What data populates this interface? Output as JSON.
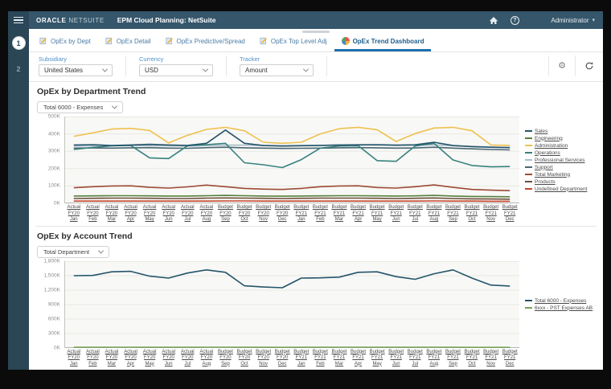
{
  "header": {
    "brand_primary": "ORACLE",
    "brand_secondary": "NETSUITE",
    "app_title": "EPM Cloud Planning: NetSuite",
    "user_menu": "Administrator"
  },
  "icons": {
    "gear": "⚙",
    "caret_down": "▾"
  },
  "sidebar": {
    "pages": [
      "1",
      "2"
    ],
    "active_page": "1"
  },
  "tabs": [
    {
      "label": "OpEx by Dept",
      "active": false
    },
    {
      "label": "OpEx Detail",
      "active": false
    },
    {
      "label": "OpEx Predictive/Spread",
      "active": false
    },
    {
      "label": "OpEx Top Level Adj",
      "active": false
    },
    {
      "label": "OpEx Trend Dashboard",
      "active": true
    }
  ],
  "filters": [
    {
      "label": "Subsidiary",
      "value": "United States"
    },
    {
      "label": "Currency",
      "value": "USD"
    },
    {
      "label": "Tracker",
      "value": "Amount"
    }
  ],
  "chart_data": [
    {
      "type": "line",
      "title": "OpEx by Department Trend",
      "selector": "Total 6000 - Expenses",
      "ylim": [
        0,
        500
      ],
      "yticks": [
        "500K",
        "400K",
        "300K",
        "200K",
        "100K",
        "0K"
      ],
      "grid": true,
      "legend_position": "right",
      "categories": [
        [
          "Actual",
          "FY20",
          "Jan"
        ],
        [
          "Actual",
          "FY20",
          "Feb"
        ],
        [
          "Actual",
          "FY20",
          "Mar"
        ],
        [
          "Actual",
          "FY20",
          "Apr"
        ],
        [
          "Actual",
          "FY20",
          "May"
        ],
        [
          "Actual",
          "FY20",
          "Jun"
        ],
        [
          "Actual",
          "FY20",
          "Jul"
        ],
        [
          "Actual",
          "FY20",
          "Aug"
        ],
        [
          "Budget",
          "FY20",
          "Sep"
        ],
        [
          "Budget",
          "FY20",
          "Oct"
        ],
        [
          "Budget",
          "FY20",
          "Nov"
        ],
        [
          "Budget",
          "FY20",
          "Dec"
        ],
        [
          "Budget",
          "FY21",
          "Jan"
        ],
        [
          "Budget",
          "FY21",
          "Feb"
        ],
        [
          "Budget",
          "FY21",
          "Mar"
        ],
        [
          "Budget",
          "FY21",
          "Apr"
        ],
        [
          "Budget",
          "FY21",
          "May"
        ],
        [
          "Budget",
          "FY21",
          "Jun"
        ],
        [
          "Budget",
          "FY21",
          "Jul"
        ],
        [
          "Budget",
          "FY21",
          "Aug"
        ],
        [
          "Budget",
          "FY21",
          "Sep"
        ],
        [
          "Budget",
          "FY21",
          "Oct"
        ],
        [
          "Budget",
          "FY21",
          "Nov"
        ],
        [
          "Budget",
          "FY21",
          "Dec"
        ]
      ],
      "series": [
        {
          "name": "Sales",
          "color": "#24546b",
          "z": 8,
          "values": [
            336,
            338,
            333,
            336,
            340,
            336,
            334,
            346,
            422,
            346,
            333,
            330,
            332,
            334,
            336,
            337,
            338,
            335,
            337,
            352,
            333,
            327,
            323,
            321
          ]
        },
        {
          "name": "Engineering",
          "color": "#55803e",
          "z": 4,
          "values": [
            42,
            43,
            44,
            44,
            43,
            42,
            42,
            44,
            46,
            44,
            42,
            41,
            42,
            43,
            44,
            44,
            43,
            42,
            43,
            46,
            42,
            40,
            39,
            38
          ]
        },
        {
          "name": "Administration",
          "color": "#efc14f",
          "z": 9,
          "values": [
            386,
            406,
            428,
            432,
            420,
            348,
            392,
            426,
            438,
            418,
            352,
            346,
            352,
            400,
            430,
            438,
            424,
            356,
            402,
            434,
            438,
            418,
            336,
            334
          ]
        },
        {
          "name": "Operations",
          "color": "#37817f",
          "z": 7,
          "values": [
            310,
            322,
            331,
            334,
            262,
            258,
            332,
            338,
            346,
            234,
            222,
            206,
            252,
            318,
            330,
            332,
            246,
            242,
            330,
            346,
            250,
            218,
            210,
            212
          ]
        },
        {
          "name": "Professional Services",
          "color": "#a9bdc8",
          "z": 5,
          "values": [
            330,
            331,
            332,
            333,
            332,
            331,
            330,
            333,
            335,
            335,
            333,
            332,
            333,
            334,
            336,
            336,
            335,
            334,
            335,
            337,
            332,
            328,
            324,
            322
          ]
        },
        {
          "name": "Support",
          "color": "#4a6673",
          "z": 6,
          "values": [
            318,
            319,
            318,
            320,
            321,
            318,
            317,
            321,
            323,
            320,
            318,
            316,
            317,
            318,
            320,
            321,
            320,
            318,
            319,
            323,
            318,
            314,
            310,
            308
          ]
        },
        {
          "name": "Total Marketing",
          "color": "#9d4a35",
          "z": 3,
          "values": [
            90,
            96,
            100,
            101,
            92,
            88,
            95,
            105,
            96,
            86,
            82,
            80,
            86,
            96,
            100,
            101,
            91,
            88,
            96,
            106,
            92,
            80,
            76,
            73
          ]
        },
        {
          "name": "Products",
          "color": "#6e4f3c",
          "z": 2,
          "values": [
            28,
            29,
            30,
            30,
            29,
            28,
            28,
            30,
            31,
            30,
            29,
            28,
            29,
            30,
            30,
            30,
            29,
            28,
            29,
            31,
            28,
            26,
            25,
            24
          ]
        },
        {
          "name": "Undefined Department",
          "color": "#c8452c",
          "z": 1,
          "values": [
            13,
            13,
            13,
            13,
            13,
            13,
            13,
            13,
            14,
            14,
            13,
            13,
            13,
            13,
            13,
            13,
            13,
            13,
            13,
            14,
            13,
            13,
            12,
            12
          ]
        }
      ]
    },
    {
      "type": "line",
      "title": "OpEx by Account Trend",
      "selector": "Total Department",
      "ylim": [
        0,
        1800
      ],
      "yticks": [
        "1,800K",
        "1,500K",
        "1,200K",
        "900K",
        "600K",
        "300K",
        "0K"
      ],
      "grid": true,
      "legend_position": "right",
      "categories": [
        [
          "Actual",
          "FY20",
          "Jan"
        ],
        [
          "Actual",
          "FY20",
          "Feb"
        ],
        [
          "Actual",
          "FY20",
          "Mar"
        ],
        [
          "Actual",
          "FY20",
          "Apr"
        ],
        [
          "Actual",
          "FY20",
          "May"
        ],
        [
          "Actual",
          "FY20",
          "Jun"
        ],
        [
          "Actual",
          "FY20",
          "Jul"
        ],
        [
          "Actual",
          "FY20",
          "Aug"
        ],
        [
          "Budget",
          "FY20",
          "Sep"
        ],
        [
          "Budget",
          "FY20",
          "Oct"
        ],
        [
          "Budget",
          "FY20",
          "Nov"
        ],
        [
          "Budget",
          "FY20",
          "Dec"
        ],
        [
          "Budget",
          "FY21",
          "Jan"
        ],
        [
          "Budget",
          "FY21",
          "Feb"
        ],
        [
          "Budget",
          "FY21",
          "Mar"
        ],
        [
          "Budget",
          "FY21",
          "Apr"
        ],
        [
          "Budget",
          "FY21",
          "May"
        ],
        [
          "Budget",
          "FY21",
          "Jun"
        ],
        [
          "Budget",
          "FY21",
          "Jul"
        ],
        [
          "Budget",
          "FY21",
          "Aug"
        ],
        [
          "Budget",
          "FY21",
          "Sep"
        ],
        [
          "Budget",
          "FY21",
          "Oct"
        ],
        [
          "Budget",
          "FY21",
          "Nov"
        ],
        [
          "Budget",
          "FY21",
          "Dec"
        ]
      ],
      "series": [
        {
          "name": "Total 6000 - Expenses",
          "color": "#24546b",
          "z": 2,
          "values": [
            1500,
            1505,
            1580,
            1590,
            1490,
            1450,
            1555,
            1620,
            1570,
            1290,
            1265,
            1250,
            1450,
            1455,
            1470,
            1570,
            1580,
            1480,
            1425,
            1540,
            1620,
            1450,
            1305,
            1285
          ]
        },
        {
          "name": "6xxx - PST Expenses AB",
          "color": "#76a15a",
          "z": 1,
          "values": [
            15,
            15,
            16,
            16,
            15,
            15,
            15,
            16,
            16,
            15,
            15,
            14,
            15,
            15,
            16,
            16,
            15,
            15,
            15,
            16,
            15,
            14,
            14,
            14
          ]
        }
      ]
    }
  ]
}
